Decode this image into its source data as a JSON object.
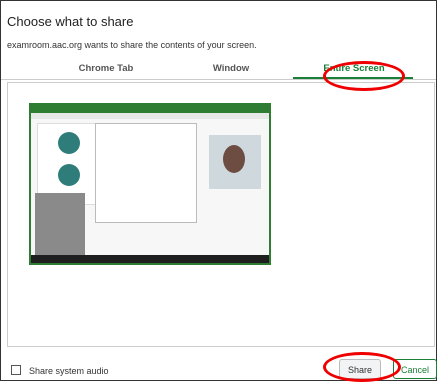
{
  "dialog": {
    "title": "Choose what to share",
    "subtitle": "examroom.aac.org wants to share the contents of your screen."
  },
  "tabs": [
    {
      "label": "Chrome Tab",
      "active": false
    },
    {
      "label": "Window",
      "active": false
    },
    {
      "label": "Entire Screen",
      "active": true
    }
  ],
  "footer": {
    "checkbox_label": "Share system audio",
    "share_label": "Share",
    "cancel_label": "Cancel"
  },
  "colors": {
    "accent": "#1a7f37",
    "highlight": "#e00000"
  }
}
